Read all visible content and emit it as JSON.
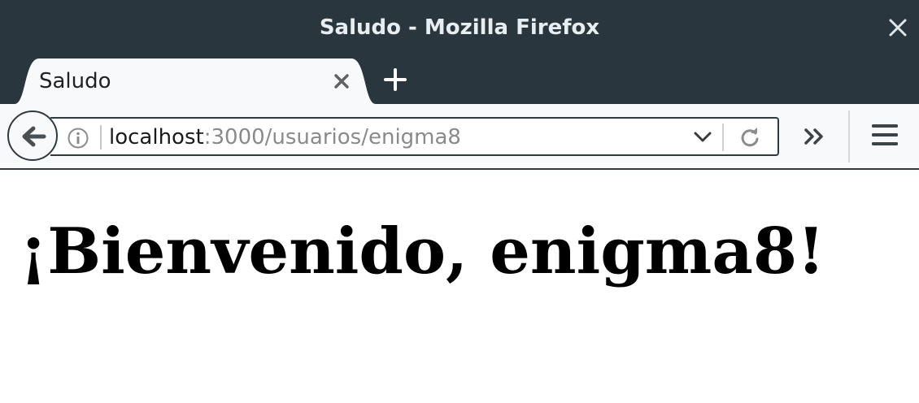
{
  "window": {
    "title": "Saludo - Mozilla Firefox"
  },
  "tabs": [
    {
      "title": "Saludo",
      "active": true
    }
  ],
  "urlbar": {
    "host": "localhost",
    "path": ":3000/usuarios/enigma8"
  },
  "page": {
    "heading": "¡Bienvenido, enigma8!"
  },
  "icons": {
    "close": "close-icon",
    "tab_close": "tab-close-icon",
    "new_tab": "plus-icon",
    "back": "back-arrow-icon",
    "info": "info-icon",
    "dropdown": "chevron-down-icon",
    "reload": "reload-icon",
    "overflow": "double-chevron-icon",
    "menu": "hamburger-icon"
  },
  "colors": {
    "chrome": "#2a363e",
    "toolbar": "#f8f9fa"
  }
}
